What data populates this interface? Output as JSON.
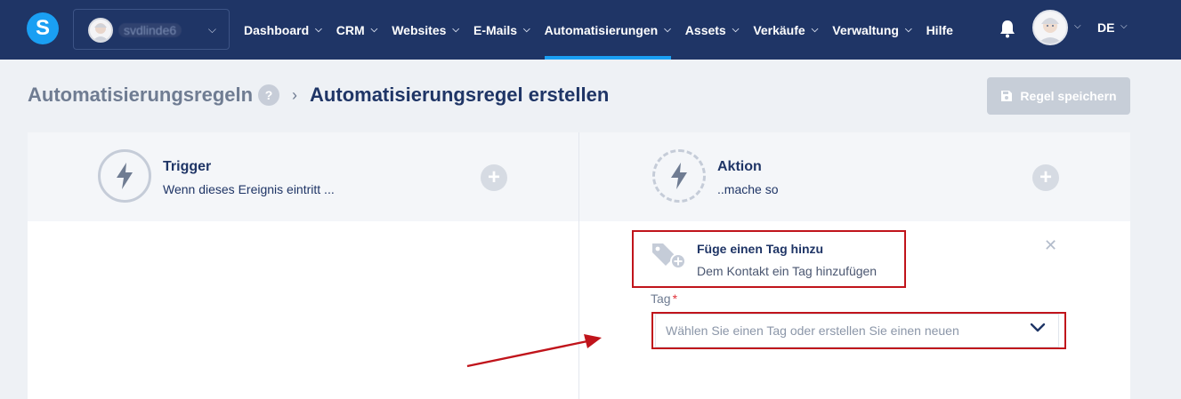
{
  "topbar": {
    "logo": "S",
    "account_name": "svdlinde6",
    "nav": [
      "Dashboard",
      "CRM",
      "Websites",
      "E-Mails",
      "Automatisierungen",
      "Assets",
      "Verkäufe",
      "Verwaltung",
      "Hilfe"
    ],
    "active_nav": "Automatisierungen",
    "language": "DE"
  },
  "breadcrumb": {
    "parent": "Automatisierungsregeln",
    "help": "?",
    "current": "Automatisierungsregel erstellen"
  },
  "save_button": {
    "label": "Regel speichern"
  },
  "trigger": {
    "title": "Trigger",
    "subtitle": "Wenn dieses Ereignis eintritt ..."
  },
  "action": {
    "title": "Aktion",
    "subtitle": "..mache so"
  },
  "action_card": {
    "title": "Füge einen Tag hinzu",
    "description": "Dem Kontakt ein Tag hinzufügen"
  },
  "tag_field": {
    "label": "Tag",
    "required_mark": "*",
    "placeholder": "Wählen Sie einen Tag oder erstellen Sie einen neuen"
  },
  "colors": {
    "topbar": "#1f3566",
    "accent": "#1a9ff3",
    "annotation_red": "#c0141b",
    "disabled_button": "#c7ced8"
  }
}
